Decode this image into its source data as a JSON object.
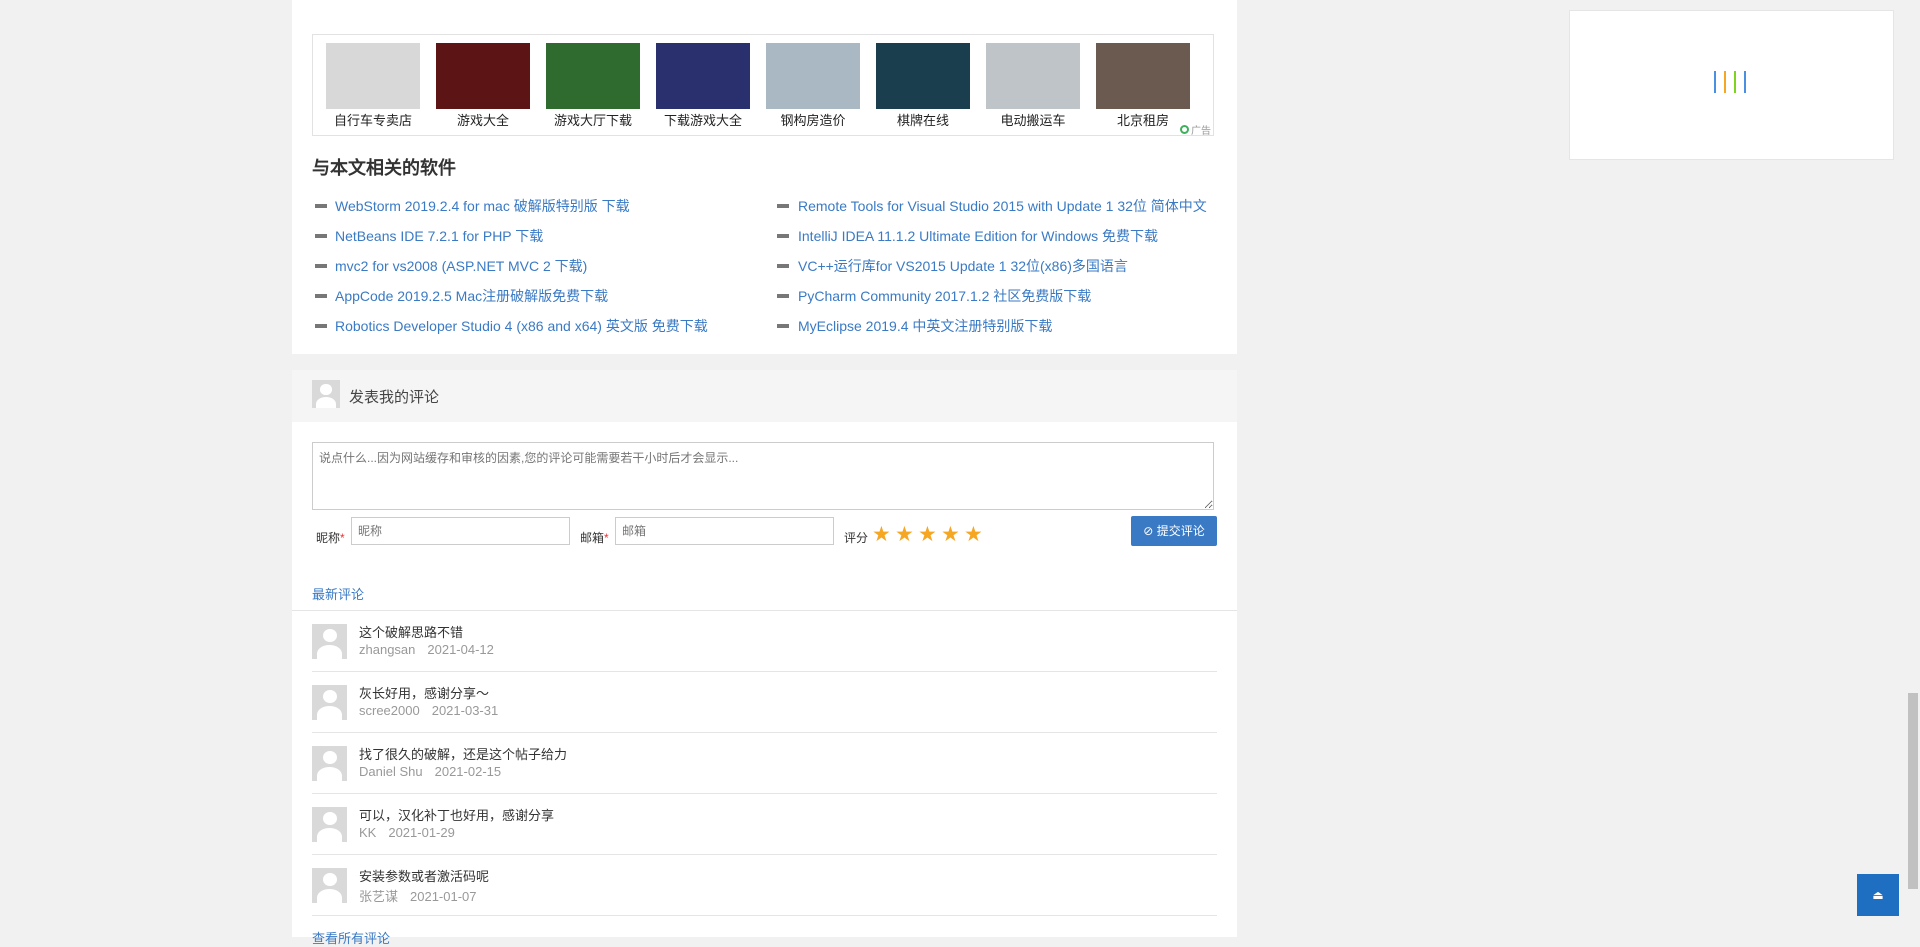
{
  "ads": {
    "items": [
      {
        "label": "自行车专卖店",
        "thumb_color": "#d8d8d8",
        "thumb_icon": "bicycle-thumbnail"
      },
      {
        "label": "游戏大全",
        "thumb_color": "#5c1414",
        "thumb_icon": "game-character-thumbnail"
      },
      {
        "label": "游戏大厅下载",
        "thumb_color": "#2f6a2e",
        "thumb_icon": "fish-game-thumbnail"
      },
      {
        "label": "下载游戏大全",
        "thumb_color": "#2a2f6e",
        "thumb_icon": "fantasy-game-thumbnail"
      },
      {
        "label": "钢构房造价",
        "thumb_color": "#aab8c4",
        "thumb_icon": "steel-house-thumbnail"
      },
      {
        "label": "棋牌在线",
        "thumb_color": "#1b3e4e",
        "thumb_icon": "card-game-thumbnail"
      },
      {
        "label": "电动搬运车",
        "thumb_color": "#bfc4c8",
        "thumb_icon": "truck-thumbnail"
      },
      {
        "label": "北京租房",
        "thumb_color": "#6a5a50",
        "thumb_icon": "room-thumbnail"
      }
    ],
    "mark": "广告"
  },
  "related": {
    "title": "与本文相关的软件",
    "left": [
      "WebStorm 2019.2.4 for mac 破解版特别版 下载",
      "NetBeans IDE 7.2.1 for PHP 下载",
      "mvc2 for vs2008 (ASP.NET MVC 2 下载)",
      "AppCode 2019.2.5 Mac注册破解版免费下载",
      "Robotics Developer Studio 4 (x86 and x64) 英文版 免费下载"
    ],
    "right": [
      "Remote Tools for Visual Studio 2015 with Update 1 32位 简体中文",
      "IntelliJ IDEA 11.1.2 Ultimate Edition for Windows 免费下载",
      "VC++运行库for VS2015 Update 1 32位(x86)多国语言",
      "PyCharm Community 2017.1.2 社区免费版下载",
      "MyEclipse 2019.4 中英文注册特别版下载"
    ]
  },
  "comment_form": {
    "title": "发表我的评论",
    "textarea_placeholder": "说点什么...因为网站缓存和审核的因素,您的评论可能需要若干小时后才会显示...",
    "nickname_label": "昵称",
    "nickname_placeholder": "昵称",
    "email_label": "邮箱",
    "email_placeholder": "邮箱",
    "required_mark": "*",
    "rating_label": "评分",
    "rating": 5,
    "rating_max": 5,
    "submit_icon": "clock-icon",
    "submit_label": "提交评论"
  },
  "comments": {
    "title": "最新评论",
    "items": [
      {
        "text": "这个破解思路不错",
        "user": "zhangsan",
        "date": "2021-04-12"
      },
      {
        "text": "灰长好用，感谢分享～",
        "user": "scree2000",
        "date": "2021-03-31"
      },
      {
        "text": "找了很久的破解，还是这个帖子给力",
        "user": "Daniel Shu",
        "date": "2021-02-15"
      },
      {
        "text": "可以，汉化补丁也好用，感谢分享",
        "user": "KK",
        "date": "2021-01-29"
      },
      {
        "text": "安装参数或者激活码呢",
        "user": "张艺谋",
        "date": "2021-01-07"
      }
    ],
    "view_all": "查看所有评论"
  },
  "loader_colors": [
    "#4a90e2",
    "#f5a623",
    "#7ed321",
    "#4a90e2"
  ],
  "back_to_top_icon": "triangle-up-icon"
}
